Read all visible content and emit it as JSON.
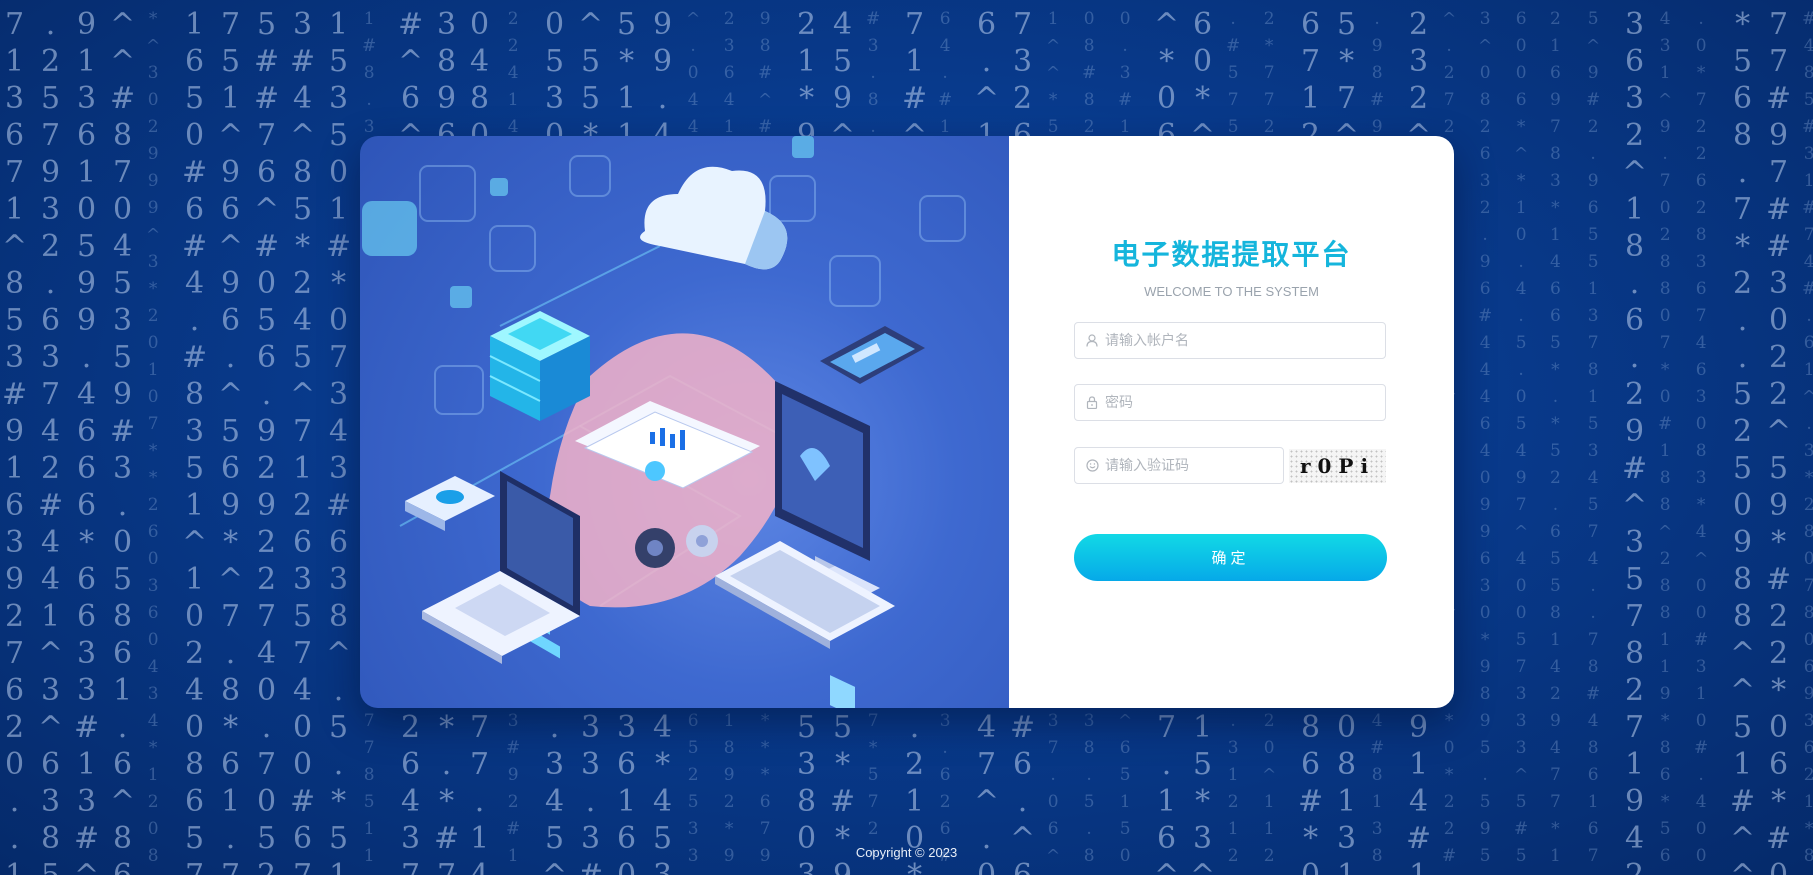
{
  "login": {
    "title": "电子数据提取平台",
    "subtitle": "WELCOME TO THE SYSTEM",
    "username": {
      "placeholder": "请输入帐户名",
      "value": "",
      "icon": "user-icon"
    },
    "password": {
      "placeholder": "密码",
      "value": "",
      "icon": "lock-icon"
    },
    "captcha_input": {
      "placeholder": "请输入验证码",
      "value": "",
      "icon": "smile-icon"
    },
    "captcha_image_text": "r0Pi",
    "submit_label": "确定"
  },
  "footer": {
    "copyright": "Copyright © 2023"
  },
  "colors": {
    "title": "#15b5dc",
    "button_gradient": [
      "#12d9e6",
      "#06a9e8"
    ],
    "background": "#083a8c"
  }
}
